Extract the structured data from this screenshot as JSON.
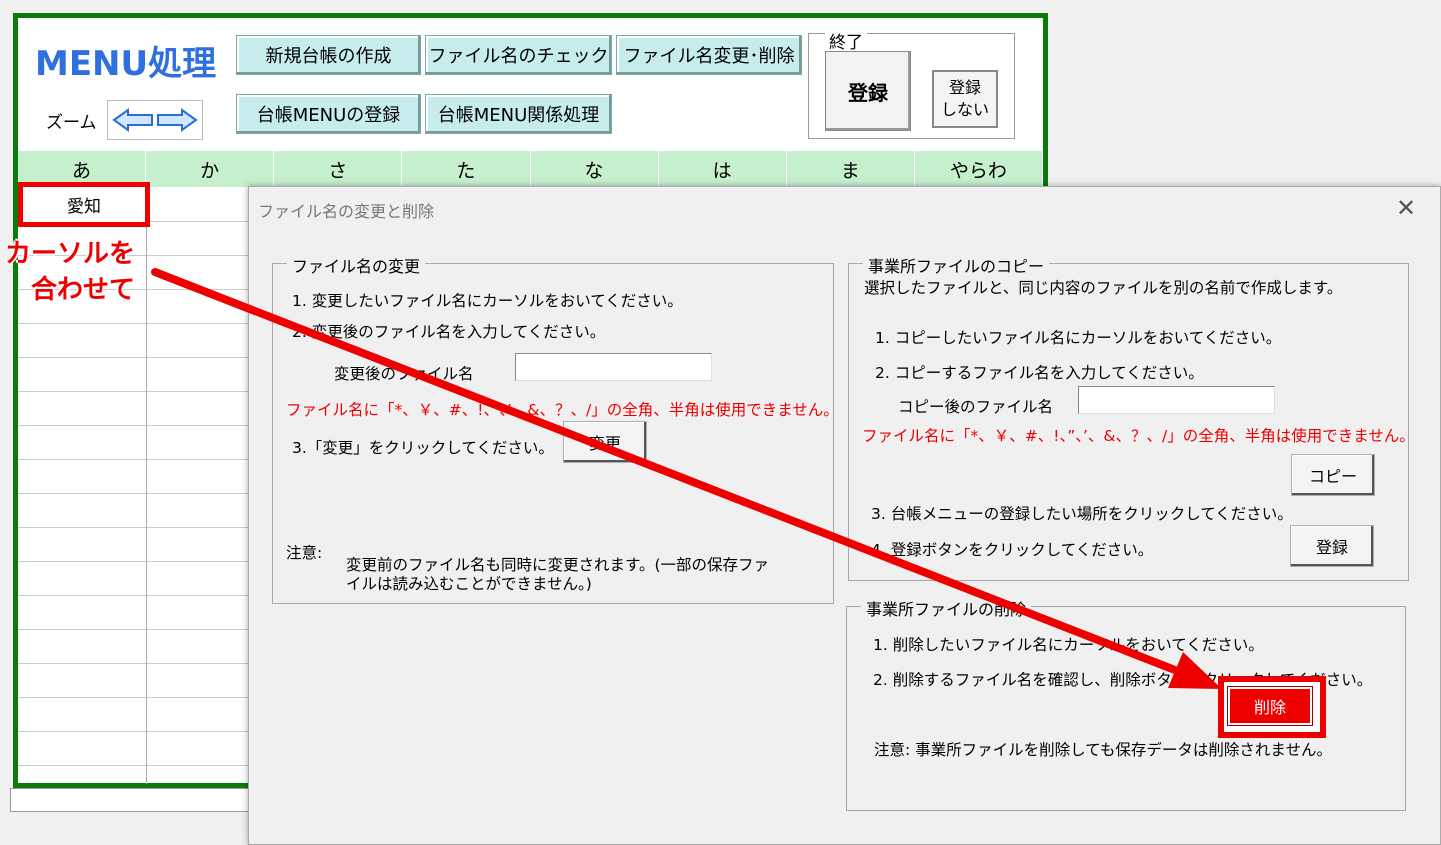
{
  "sheet": {
    "title": "MENU処理",
    "buttons": [
      "新規台帳の作成",
      "ファイル名のチェック",
      "ファイル名変更･削除",
      "台帳MENUの登録",
      "台帳MENU関係処理"
    ],
    "zoom_label": "ズーム",
    "end_group_label": "終了",
    "register_label": "登録",
    "no_register_line1": "登録",
    "no_register_line2": "しない",
    "kana_columns": [
      "あ",
      "か",
      "さ",
      "た",
      "な",
      "は",
      "ま",
      "やらわ"
    ],
    "selected_cell": "愛知"
  },
  "annotation": {
    "line1": "カーソルを",
    "line2": "合わせて",
    "color": "#e00000"
  },
  "dialog": {
    "title": "ファイル名の変更と削除",
    "rename": {
      "label": "ファイル名の変更",
      "step1": "1. 変更したいファイル名にカーソルをおいてください。",
      "step2": "2. 変更後のファイル名を入力してください。",
      "field_label": "変更後のファイル名",
      "field_value": "",
      "warning": "ファイル名に「*、￥、#、!、”、’、&、？、/」の全角、半角は使用できません。",
      "step3": "3.「変更」をクリックしてください。",
      "button": "変更",
      "note_label": "注意:",
      "note_line1": "変更前のファイル名も同時に変更されます。(一部の保存ファ",
      "note_line2": "イルは読み込むことができません。)"
    },
    "copy": {
      "label": "事業所ファイルのコピー",
      "intro": "選択したファイルと、同じ内容のファイルを別の名前で作成します。",
      "step1": "1. コピーしたいファイル名にカーソルをおいてください。",
      "step2": "2. コピーするファイル名を入力してください。",
      "field_label": "コピー後のファイル名",
      "field_value": "",
      "warning": "ファイル名に「*、￥、#、!、”、’、&、？、/」の全角、半角は使用できません。",
      "copy_button": "コピー",
      "step3": "3. 台帳メニューの登録したい場所をクリックしてください。",
      "step4": "4. 登録ボタンをクリックしてください。",
      "register_button": "登録"
    },
    "delete": {
      "label": "事業所ファイルの削除",
      "step1": "1. 削除したいファイル名にカーソルをおいてください。",
      "step2": "2. 削除するファイル名を確認し、削除ボタンをクリックしてください。",
      "button": "削除",
      "note": "注意:  事業所ファイルを削除しても保存データは削除されません。"
    }
  }
}
